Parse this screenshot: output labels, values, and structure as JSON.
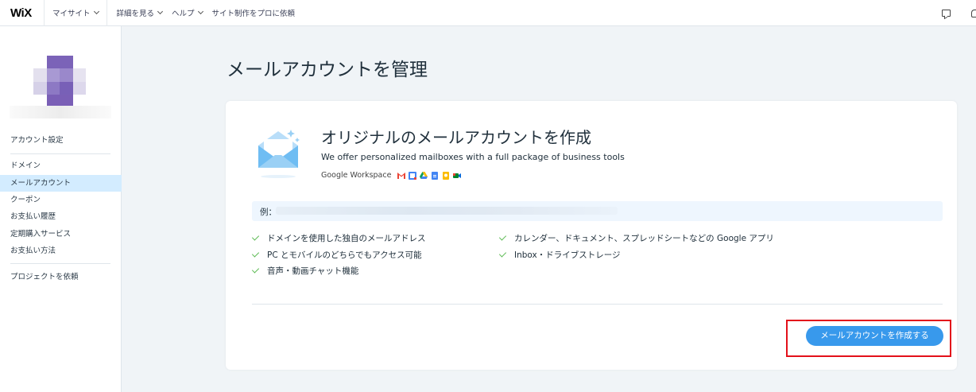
{
  "topbar": {
    "logo": "WiX",
    "nav": {
      "my_sites": "マイサイト",
      "explore": "詳細を見る",
      "help": "ヘルプ",
      "hire_pro": "サイト制作をプロに依頼"
    }
  },
  "sidebar": {
    "account_settings": "アカウント設定",
    "items": [
      {
        "label": "ドメイン"
      },
      {
        "label": "メールアカウント"
      },
      {
        "label": "クーポン"
      },
      {
        "label": "お支払い履歴"
      },
      {
        "label": "定期購入サービス"
      },
      {
        "label": "お支払い方法"
      }
    ],
    "hire_project": "プロジェクトを依頼"
  },
  "main": {
    "page_title": "メールアカウントを管理",
    "card": {
      "title": "オリジナルのメールアカウントを作成",
      "subtitle": "We offer personalized mailboxes with a full package of business tools",
      "workspace_label": "Google Workspace",
      "example_label": "例：",
      "features_left": [
        "ドメインを使用した独自のメールアドレス",
        "PC とモバイルのどちらでもアクセス可能",
        "音声・動画チャット機能"
      ],
      "features_right": [
        "カレンダー、ドキュメント、スプレッドシートなどの Google アプリ",
        "Inbox・ドライブストレージ"
      ],
      "cta": "メールアカウントを作成する"
    }
  },
  "colors": {
    "accent": "#3899ec",
    "active_bg": "#d3ecff",
    "check": "#60bc57",
    "highlight_frame": "#e3101a"
  }
}
